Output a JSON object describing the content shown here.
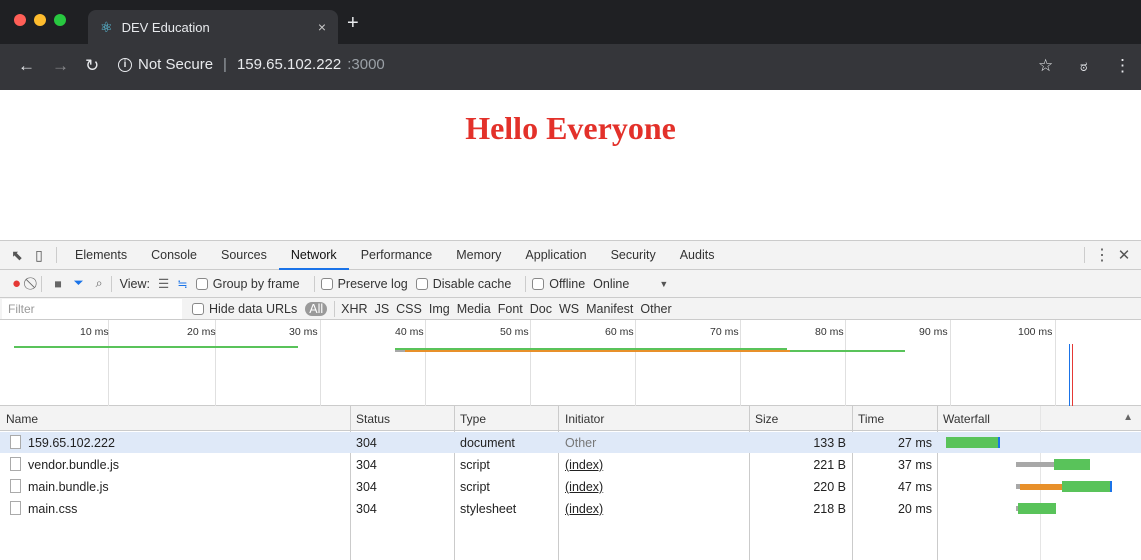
{
  "browser": {
    "tab_title": "DEV Education",
    "tab_favicon": "react-atom-icon",
    "tab_close": "×",
    "new_tab": "+",
    "security_label": "Not Secure",
    "url_host": "159.65.102.222",
    "url_port": ":3000",
    "traffic_lights": [
      "#ff5f57",
      "#febc2e",
      "#28c840"
    ]
  },
  "page": {
    "heading": "Hello Everyone",
    "heading_color": "#e3312a"
  },
  "devtools": {
    "tabs": [
      "Elements",
      "Console",
      "Sources",
      "Network",
      "Performance",
      "Memory",
      "Application",
      "Security",
      "Audits"
    ],
    "active_tab": "Network",
    "controls": {
      "view_label": "View:",
      "group_by_frame": "Group by frame",
      "preserve_log": "Preserve log",
      "disable_cache": "Disable cache",
      "offline": "Offline",
      "throttle": "Online"
    },
    "filter": {
      "placeholder": "Filter",
      "hide_data_urls": "Hide data URLs",
      "types": [
        "All",
        "XHR",
        "JS",
        "CSS",
        "Img",
        "Media",
        "Font",
        "Doc",
        "WS",
        "Manifest",
        "Other"
      ]
    },
    "overview_ticks": [
      "10 ms",
      "20 ms",
      "30 ms",
      "40 ms",
      "50 ms",
      "60 ms",
      "70 ms",
      "80 ms",
      "90 ms",
      "100 ms"
    ],
    "columns": [
      "Name",
      "Status",
      "Type",
      "Initiator",
      "Size",
      "Time",
      "Waterfall"
    ],
    "requests": [
      {
        "name": "159.65.102.222",
        "status": "304",
        "type": "document",
        "initiator": "Other",
        "size": "133 B",
        "time": "27 ms"
      },
      {
        "name": "vendor.bundle.js",
        "status": "304",
        "type": "script",
        "initiator": "(index)",
        "size": "221 B",
        "time": "37 ms"
      },
      {
        "name": "main.bundle.js",
        "status": "304",
        "type": "script",
        "initiator": "(index)",
        "size": "220 B",
        "time": "47 ms"
      },
      {
        "name": "main.css",
        "status": "304",
        "type": "stylesheet",
        "initiator": "(index)",
        "size": "218 B",
        "time": "20 ms"
      }
    ],
    "colors": {
      "record": "#e53935",
      "accent": "#1a73e8",
      "waiting": "#a8a8a8",
      "download": "#59c35a",
      "ttfb": "#e8902a",
      "selected_row": "#dfe9f8"
    }
  }
}
